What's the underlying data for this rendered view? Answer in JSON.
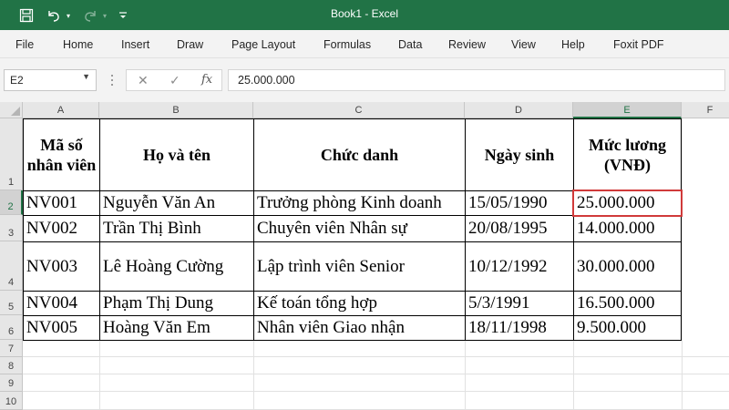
{
  "titlebar": {
    "title": "Book1  -  Excel",
    "bg": "#217346"
  },
  "menu": [
    "File",
    "Home",
    "Insert",
    "Draw",
    "Page Layout",
    "Formulas",
    "Data",
    "Review",
    "View",
    "Help",
    "Foxit PDF"
  ],
  "formula_bar": {
    "name_box": "E2",
    "value": "25.000.000",
    "fx_label": "fx"
  },
  "columns": [
    "A",
    "B",
    "C",
    "D",
    "E",
    "F"
  ],
  "rows": [
    "1",
    "2",
    "3",
    "4",
    "5",
    "6",
    "7",
    "8",
    "9",
    "10"
  ],
  "table": {
    "headers": [
      "Mã số nhân viên",
      "Họ và tên",
      "Chức danh",
      "Ngày sinh",
      "Mức lương (VNĐ)"
    ],
    "rows": [
      [
        "NV001",
        "Nguyễn Văn An",
        "Trưởng phòng Kinh doanh",
        "15/05/1990",
        "25.000.000"
      ],
      [
        "NV002",
        "Trần Thị Bình",
        "Chuyên viên Nhân sự",
        "20/08/1995",
        "14.000.000"
      ],
      [
        "NV003",
        "Lê Hoàng Cường",
        "Lập trình viên Senior",
        "10/12/1992",
        "30.000.000"
      ],
      [
        "NV004",
        "Phạm Thị Dung",
        "Kế toán tổng hợp",
        "5/3/1991",
        "16.500.000"
      ],
      [
        "NV005",
        "Hoàng Văn Em",
        "Nhân viên Giao nhận",
        "18/11/1998",
        "9.500.000"
      ]
    ]
  },
  "selected_cell": "E2",
  "colors": {
    "accent": "#217346",
    "selection_border": "#d03a3a"
  }
}
